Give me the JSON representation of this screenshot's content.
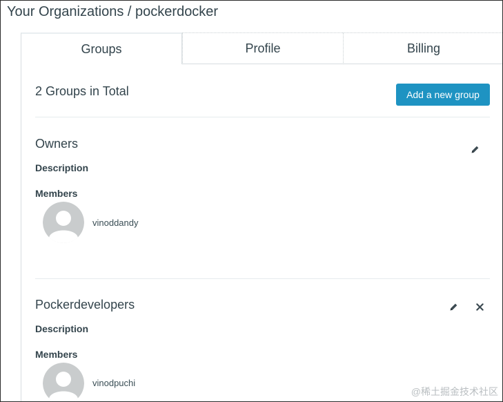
{
  "page": {
    "title": "Your Organizations / pockerdocker"
  },
  "tabs": [
    {
      "label": "Groups",
      "active": true
    },
    {
      "label": "Profile",
      "active": false
    },
    {
      "label": "Billing",
      "active": false
    }
  ],
  "groups_panel": {
    "total_text": "2 Groups in Total",
    "add_button_label": "Add a new group",
    "groups": [
      {
        "name": "Owners",
        "description_label": "Description",
        "members_label": "Members",
        "members": [
          {
            "username": "vinoddandy",
            "avatar_icon": "default-avatar-icon"
          }
        ],
        "actions": [
          "edit-icon"
        ]
      },
      {
        "name": "Pockerdevelopers",
        "description_label": "Description",
        "members_label": "Members",
        "members": [
          {
            "username": "vinodpuchi",
            "avatar_icon": "default-avatar-icon"
          }
        ],
        "actions": [
          "edit-icon",
          "delete-icon"
        ]
      }
    ]
  },
  "watermark": "@稀土掘金技术社区",
  "colors": {
    "accent": "#1e93c2",
    "text": "#33444c",
    "border": "#d7dde0"
  }
}
